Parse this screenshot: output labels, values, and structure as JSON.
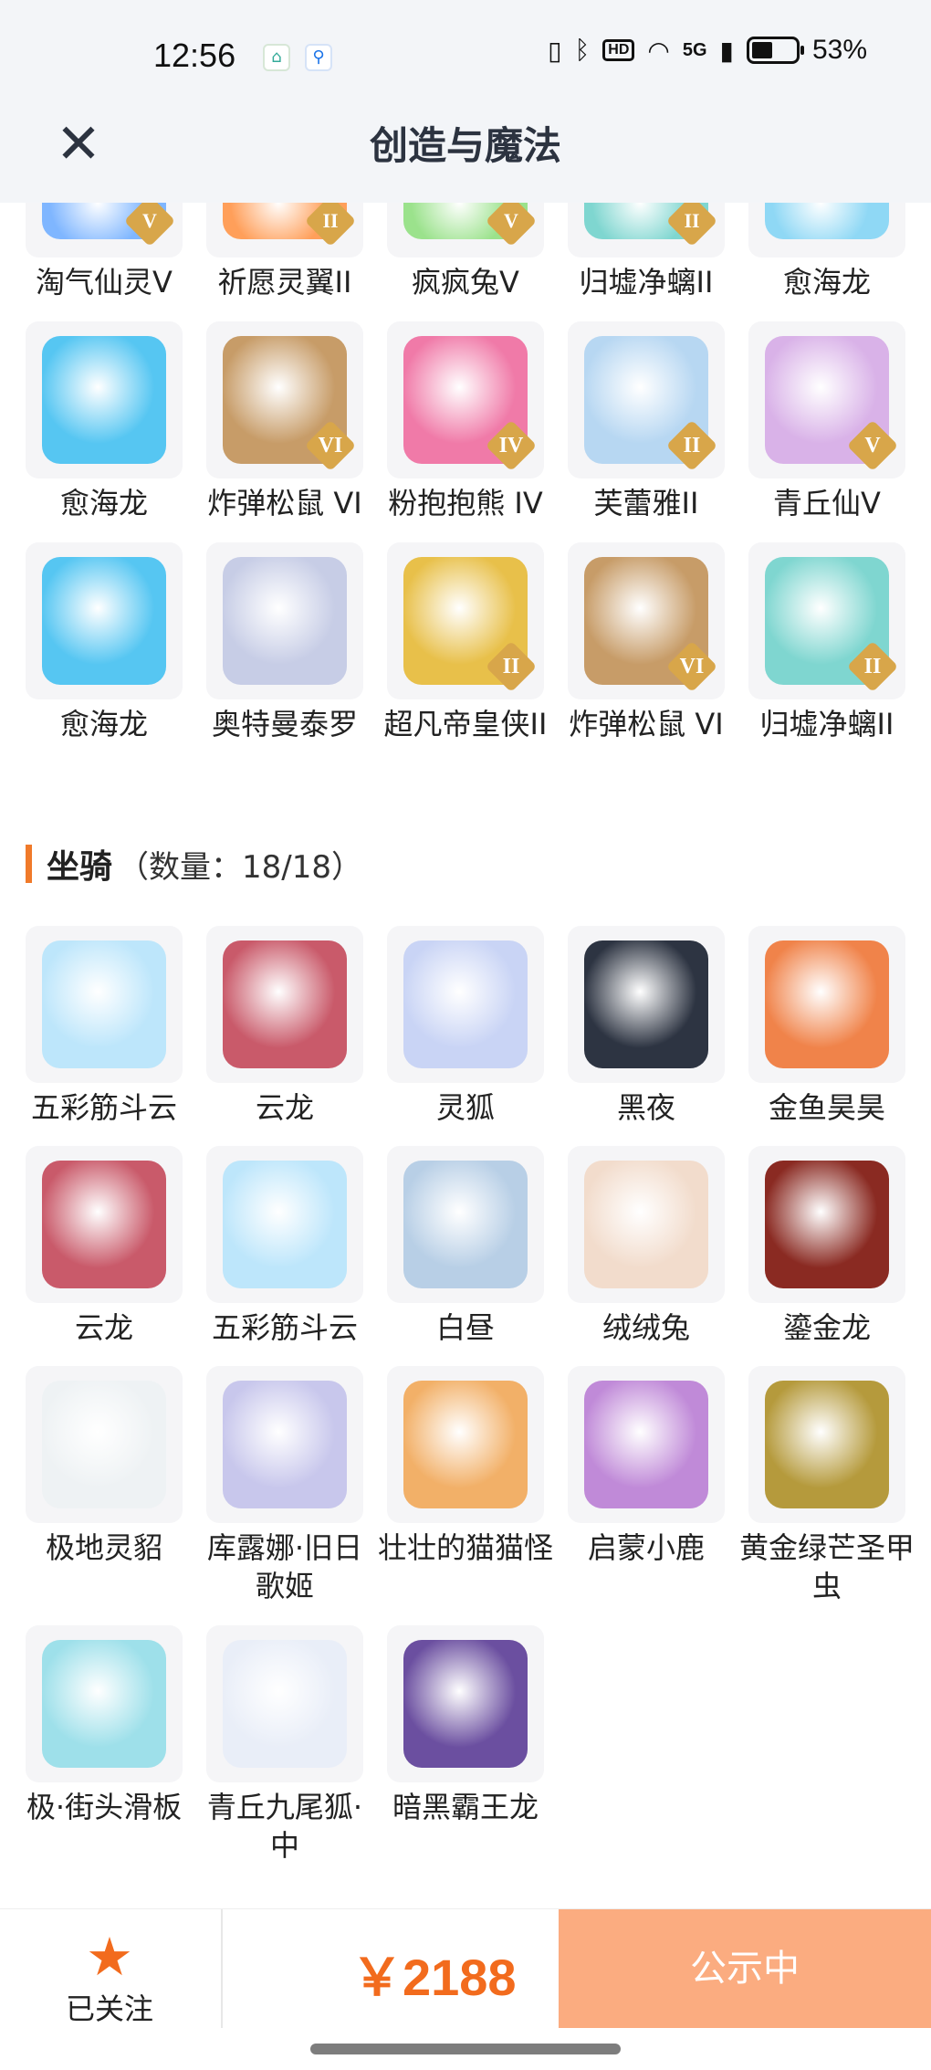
{
  "status_bar": {
    "time": "12:56",
    "hd": "HD",
    "network": "5G",
    "battery": "53%"
  },
  "header": {
    "title": "创造与魔法"
  },
  "cut_row": [
    {
      "label": "淘气仙灵V",
      "badge": "V",
      "color": "#7fb6ff"
    },
    {
      "label": "祈愿灵翼II",
      "badge": "II",
      "color": "#ff9f5a"
    },
    {
      "label": "疯疯兔V",
      "badge": "V",
      "color": "#9be28c"
    },
    {
      "label": "归墟净螭II",
      "badge": "II",
      "color": "#7fd6d0"
    },
    {
      "label": "愈海龙",
      "badge": "",
      "color": "#8fd8f5"
    }
  ],
  "pets": [
    {
      "label": "愈海龙",
      "badge": "",
      "color": "#56c6f2"
    },
    {
      "label": "炸弹松鼠 VI",
      "badge": "VI",
      "color": "#c79c68"
    },
    {
      "label": "粉抱抱熊 IV",
      "badge": "IV",
      "color": "#f07aa8"
    },
    {
      "label": "芙蕾雅II",
      "badge": "II",
      "color": "#b7d7f2"
    },
    {
      "label": "青丘仙V",
      "badge": "V",
      "color": "#d9b2e8"
    },
    {
      "label": "愈海龙",
      "badge": "",
      "color": "#56c6f2"
    },
    {
      "label": "奥特曼泰罗",
      "badge": "",
      "color": "#c7cde6"
    },
    {
      "label": "超凡帝皇侠II",
      "badge": "II",
      "color": "#e8c04a"
    },
    {
      "label": "炸弹松鼠 VI",
      "badge": "VI",
      "color": "#c79c68"
    },
    {
      "label": "归墟净螭II",
      "badge": "II",
      "color": "#7fd6d0"
    }
  ],
  "mounts_section": {
    "name": "坐骑",
    "count": "（数量：18/18）"
  },
  "mounts": [
    {
      "label": "五彩筋斗云",
      "color": "#bde6fb"
    },
    {
      "label": "云龙",
      "color": "#c95a6a"
    },
    {
      "label": "灵狐",
      "color": "#c9d4f5"
    },
    {
      "label": "黑夜",
      "color": "#2d3442"
    },
    {
      "label": "金鱼昊昊",
      "color": "#f0834a"
    },
    {
      "label": "云龙",
      "color": "#c95a6a"
    },
    {
      "label": "五彩筋斗云",
      "color": "#bde6fb"
    },
    {
      "label": "白昼",
      "color": "#b8cfe6"
    },
    {
      "label": "绒绒兔",
      "color": "#f2dccc"
    },
    {
      "label": "鎏金龙",
      "color": "#8a2a22"
    },
    {
      "label": "极地灵貂",
      "color": "#eef2f4"
    },
    {
      "label": "库露娜·旧日歌姬",
      "color": "#c8c7ec"
    },
    {
      "label": "壮壮的猫猫怪",
      "color": "#f2b068"
    },
    {
      "label": "启蒙小鹿",
      "color": "#c08ad8"
    },
    {
      "label": "黄金绿芒圣甲虫",
      "color": "#b59a3c"
    },
    {
      "label": "极·街头滑板",
      "color": "#9ee0ea"
    },
    {
      "label": "青丘九尾狐·中",
      "color": "#e9eef8"
    },
    {
      "label": "暗黑霸王龙",
      "color": "#6b4fa0"
    }
  ],
  "bottom_bar": {
    "follow_label": "已关注",
    "price": "￥2188",
    "status_label": "公示中"
  }
}
